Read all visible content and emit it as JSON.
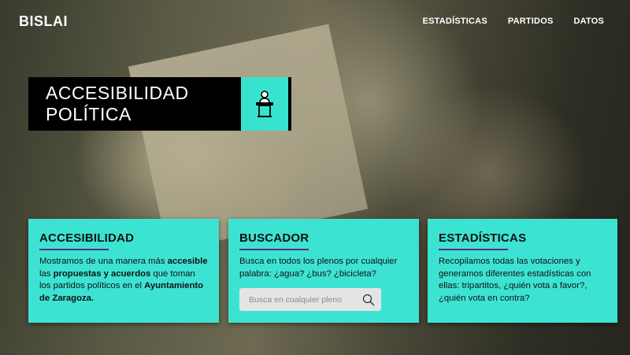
{
  "nav": {
    "brand": "BISLAI",
    "links": [
      "ESTADÍSTICAS",
      "PARTIDOS",
      "DATOS"
    ]
  },
  "hero": {
    "title": "ACCESIBILIDAD POLÍTICA",
    "icon": "podium-speaker-icon"
  },
  "cards": [
    {
      "title": "ACCESIBILIDAD",
      "text_parts": [
        "Mostramos de una manera más ",
        "accesible",
        " las ",
        "propuestas y acuerdos",
        " que toman los partidos políticos en el ",
        "Ayuntamiento de Zaragoza",
        "."
      ]
    },
    {
      "title": "BUSCADOR",
      "text": "Busca en todos los plenos por cualquier palabra: ¿agua? ¿bus? ¿bicicleta?",
      "search_placeholder": "Busca en cualquier pleno",
      "search_icon": "search-icon"
    },
    {
      "title": "ESTADÍSTICAS",
      "text": "Recopilamos todas las votaciones y generamos diferentes estadísticas con ellas: tripartitos, ¿quién vota a favor?, ¿quién vota en contra?"
    }
  ],
  "colors": {
    "accent": "#3de3d2",
    "rule": "#5b2a86",
    "title_bg": "#000000"
  }
}
